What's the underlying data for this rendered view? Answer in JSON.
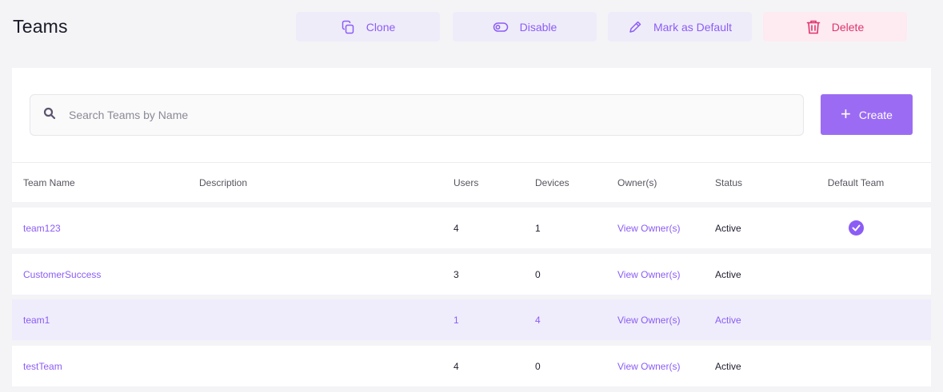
{
  "page": {
    "title": "Teams"
  },
  "actions": {
    "clone": {
      "label": "Clone",
      "icon": "clone-icon"
    },
    "disable": {
      "label": "Disable",
      "icon": "toggle-icon"
    },
    "mark_default": {
      "label": "Mark as Default",
      "icon": "pencil-icon"
    },
    "delete": {
      "label": "Delete",
      "icon": "trash-icon"
    }
  },
  "search": {
    "placeholder": "Search Teams by Name",
    "value": ""
  },
  "create": {
    "label": "Create",
    "icon": "plus-icon"
  },
  "table": {
    "headers": {
      "name": "Team Name",
      "description": "Description",
      "users": "Users",
      "devices": "Devices",
      "owners": "Owner(s)",
      "status": "Status",
      "default": "Default Team"
    },
    "rows": [
      {
        "name": "team123",
        "description": "",
        "users": "4",
        "devices": "1",
        "owners": "View Owner(s)",
        "status": "Active",
        "is_default": true,
        "selected": false
      },
      {
        "name": "CustomerSuccess",
        "description": "",
        "users": "3",
        "devices": "0",
        "owners": "View Owner(s)",
        "status": "Active",
        "is_default": false,
        "selected": false
      },
      {
        "name": "team1",
        "description": "",
        "users": "1",
        "devices": "4",
        "owners": "View Owner(s)",
        "status": "Active",
        "is_default": false,
        "selected": true
      },
      {
        "name": "testTeam",
        "description": "",
        "users": "4",
        "devices": "0",
        "owners": "View Owner(s)",
        "status": "Active",
        "is_default": false,
        "selected": false
      }
    ]
  },
  "colors": {
    "accent": "#8b5cf6",
    "accent_bg": "#efecfa",
    "danger": "#e0336c",
    "danger_bg": "#fdebf1",
    "selected_row": "#efedfb"
  }
}
